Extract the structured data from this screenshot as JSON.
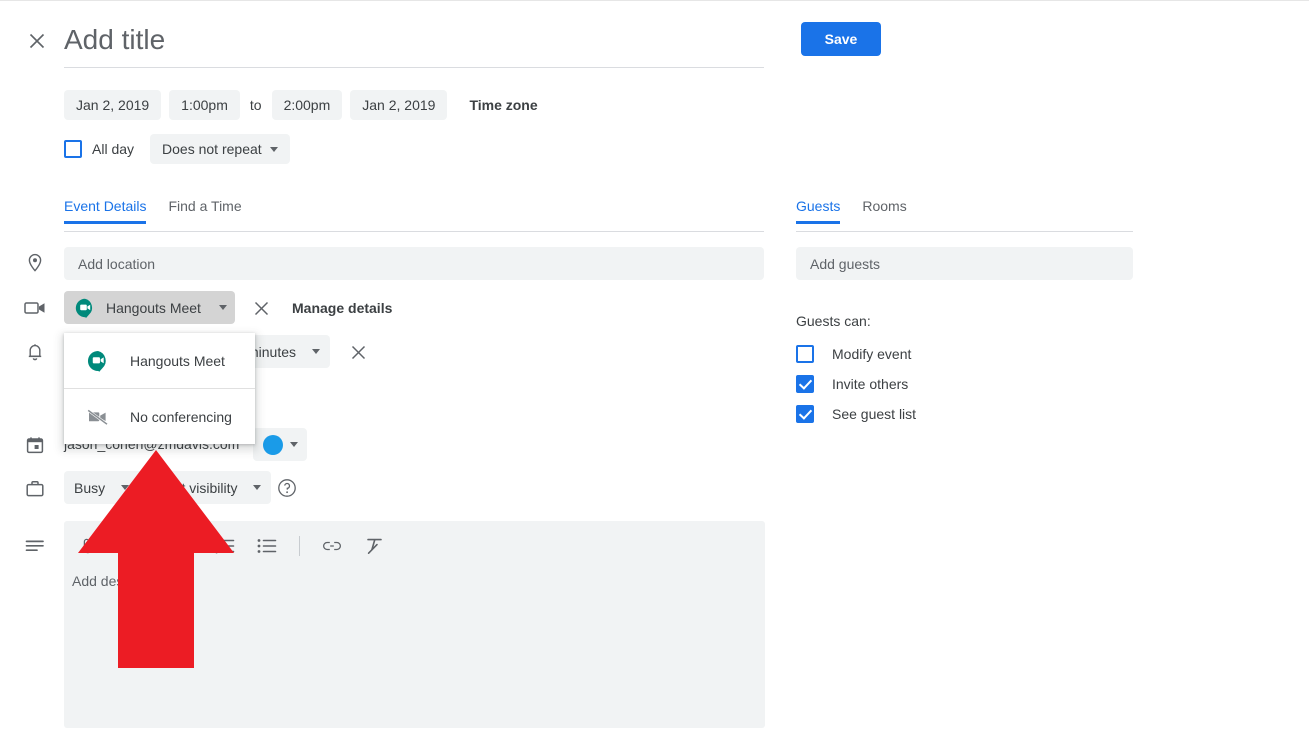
{
  "header": {
    "close_icon": "close-icon",
    "title_placeholder": "Add title",
    "save_label": "Save"
  },
  "schedule": {
    "start_date": "Jan 2, 2019",
    "start_time": "1:00pm",
    "to_label": "to",
    "end_time": "2:00pm",
    "end_date": "Jan 2, 2019",
    "timezone_label": "Time zone",
    "all_day_label": "All day",
    "all_day_checked": false,
    "repeat_label": "Does not repeat"
  },
  "tabs": {
    "left": [
      {
        "label": "Event Details",
        "active": true
      },
      {
        "label": "Find a Time",
        "active": false
      }
    ],
    "right": [
      {
        "label": "Guests",
        "active": true
      },
      {
        "label": "Rooms",
        "active": false
      }
    ]
  },
  "details": {
    "location_placeholder": "Add location",
    "conferencing_button": "Hangouts Meet",
    "manage_details_label": "Manage details",
    "notification_unit": "minutes",
    "calendar_owner": "jason_cohen@zmdavis.com",
    "busy_label": "Busy",
    "visibility_label": "Default visibility",
    "description_placeholder": "Add description"
  },
  "conferencing_menu": {
    "open": true,
    "items": [
      {
        "label": "Hangouts Meet",
        "icon": "hangouts-meet-icon"
      },
      {
        "label": "No conferencing",
        "icon": "no-video-icon"
      }
    ]
  },
  "guests": {
    "add_guests_placeholder": "Add guests",
    "guests_can_label": "Guests can:",
    "permissions": [
      {
        "label": "Modify event",
        "checked": false
      },
      {
        "label": "Invite others",
        "checked": true
      },
      {
        "label": "See guest list",
        "checked": true
      }
    ]
  },
  "editor_toolbar": [
    {
      "icon": "attachment-icon"
    },
    {
      "icon": "numbered-list-icon"
    },
    {
      "icon": "bulleted-list-icon"
    },
    {
      "icon": "link-icon"
    },
    {
      "icon": "remove-formatting-icon"
    }
  ],
  "rail_icons": [
    "location-pin-icon",
    "video-camera-icon",
    "notification-bell-icon",
    "calendar-icon",
    "briefcase-icon",
    "description-icon"
  ],
  "annotation": {
    "shape": "up-arrow",
    "color": "#ec1c24"
  },
  "colors": {
    "accent_blue": "#1a73e8",
    "field_gray": "#f1f3f4",
    "text_primary": "#3c4043",
    "text_secondary": "#5f6368",
    "calendar_dot": "#1a9be8",
    "hangouts_teal": "#00897b",
    "annotation_red": "#ec1c24"
  }
}
